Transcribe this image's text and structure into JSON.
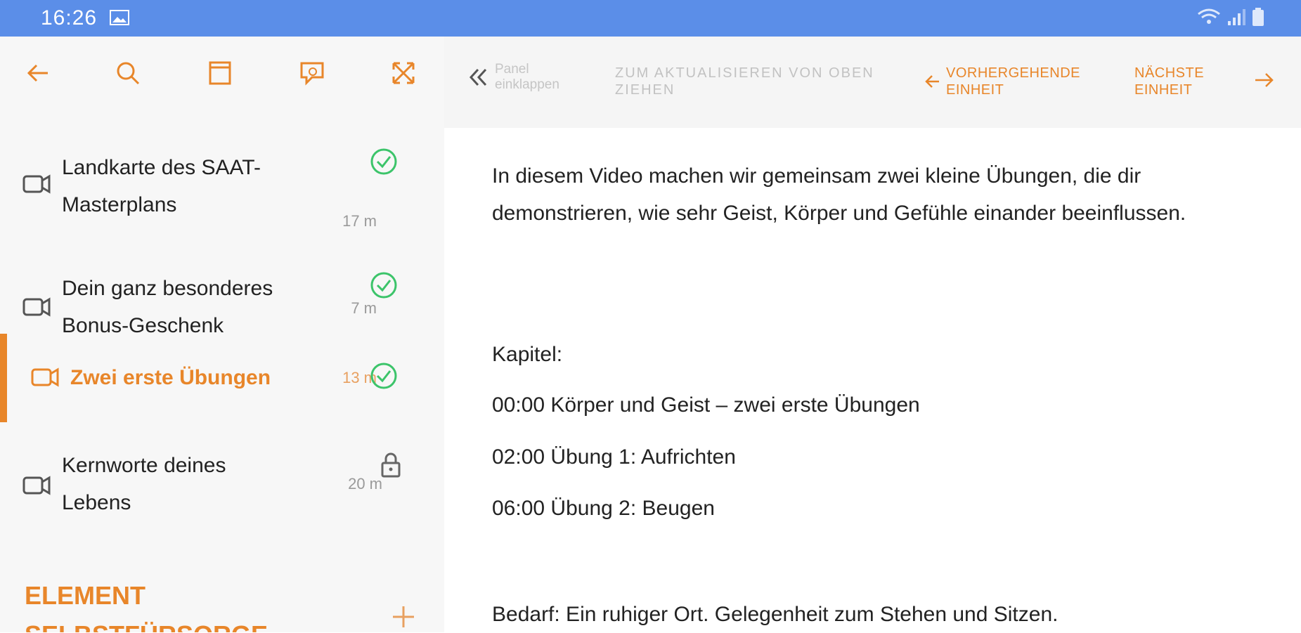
{
  "status": {
    "time": "16:26"
  },
  "toolbar": {
    "back": "arrow-left-icon",
    "search": "search-icon",
    "bookmark": "window-icon",
    "comments": "comment-icon",
    "expand": "expand-icon"
  },
  "lessons": [
    {
      "title": "Landkarte des SAAT-Masterplans",
      "duration": "17 m",
      "status": "done"
    },
    {
      "title": "Dein ganz besonderes Bonus-Geschenk",
      "duration": "7 m",
      "status": "done"
    },
    {
      "title": "Zwei erste Übungen",
      "duration": "13 m",
      "status": "done",
      "active": true
    },
    {
      "title": "Kernworte deines Lebens",
      "duration": "20 m",
      "status": "locked"
    }
  ],
  "section": {
    "title": "ELEMENT SELBSTFÜRSORGE"
  },
  "topbar": {
    "collapse_label": "Panel einklappen",
    "pull_label": "ZUM AKTUALISIEREN VON OBEN ZIEHEN",
    "prev_label": "VORHERGEHENDE EINHEIT",
    "next_label": "NÄCHSTE EINHEIT"
  },
  "content": {
    "intro": "In diesem Video machen wir gemeinsam zwei kleine Übungen, die dir demonstrieren, wie sehr Geist, Körper und Gefühle einander beeinflussen.",
    "chapters_heading": "Kapitel:",
    "chapter1": "00:00 Körper und Geist – zwei erste Übungen",
    "chapter2": "02:00 Übung 1: Aufrichten",
    "chapter3": "06:00 Übung 2: Beugen",
    "requirements": "Bedarf: Ein ruhiger Ort. Gelegenheit zum Stehen und Sitzen."
  },
  "colors": {
    "accent": "#e8862a",
    "statusbar": "#5b8ee8",
    "check": "#3cc46a"
  }
}
